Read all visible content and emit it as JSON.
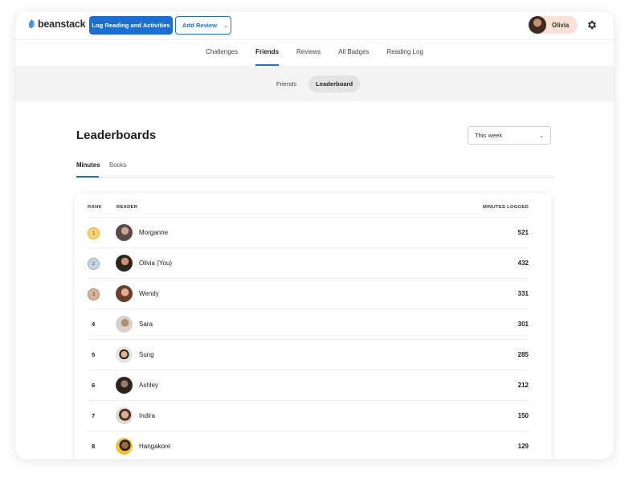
{
  "app": {
    "logo_text": "beanstack",
    "log_button": "Log Reading and Activities",
    "review_button": "Add Review",
    "user_name": "Olivia",
    "accent_color": "#1c6fd1"
  },
  "nav": {
    "tabs": [
      {
        "label": "Challenges"
      },
      {
        "label": "Friends"
      },
      {
        "label": "Reviews"
      },
      {
        "label": "All Badges"
      },
      {
        "label": "Reading Log"
      }
    ],
    "active_tab": "Friends"
  },
  "subnav": {
    "pills": [
      {
        "label": "Friends"
      },
      {
        "label": "Leaderboard"
      }
    ],
    "active": "Leaderboard"
  },
  "page": {
    "title": "Leaderboards",
    "period_select": "This week",
    "content_tabs": [
      {
        "label": "Minutes"
      },
      {
        "label": "Books"
      }
    ],
    "active_content_tab": "Minutes"
  },
  "table": {
    "headers": {
      "rank": "RANK",
      "reader": "READER",
      "minutes": "MINUTES LOGGED"
    },
    "rows": [
      {
        "rank": "1",
        "name": "Morganne",
        "minutes": "521"
      },
      {
        "rank": "2",
        "name": "Olivia (You)",
        "minutes": "432"
      },
      {
        "rank": "3",
        "name": "Wendy",
        "minutes": "331"
      },
      {
        "rank": "4",
        "name": "Sara",
        "minutes": "301"
      },
      {
        "rank": "5",
        "name": "Sung",
        "minutes": "285"
      },
      {
        "rank": "6",
        "name": "Ashley",
        "minutes": "212"
      },
      {
        "rank": "7",
        "name": "Indira",
        "minutes": "150"
      },
      {
        "rank": "8",
        "name": "Hangakore",
        "minutes": "129"
      }
    ]
  }
}
